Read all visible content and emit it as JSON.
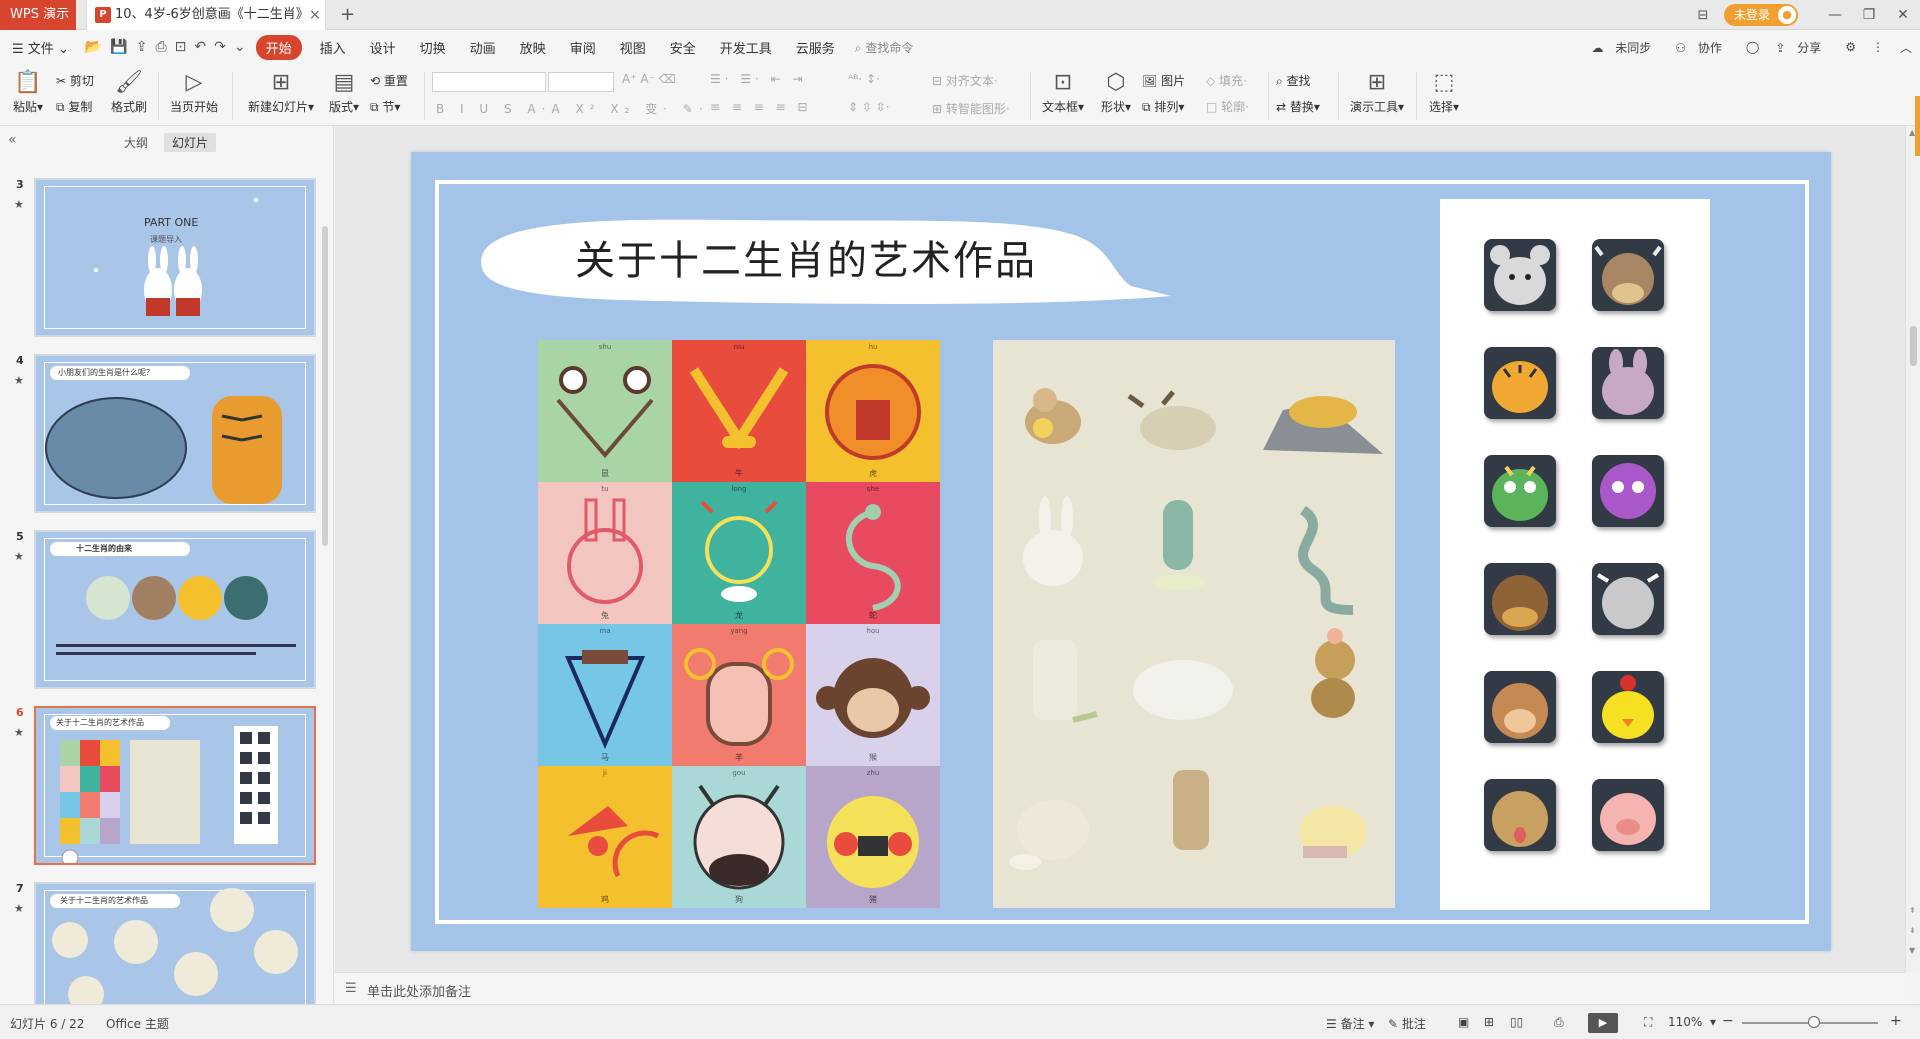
{
  "titlebar": {
    "app_tab": "WPS 演示",
    "doc_tab": "10、4岁-6岁创意画《十二生肖》",
    "doc_icon": "P",
    "login": "未登录",
    "new_tab": "+"
  },
  "menubar": {
    "file": "文件",
    "items": [
      "开始",
      "插入",
      "设计",
      "切换",
      "动画",
      "放映",
      "审阅",
      "视图",
      "安全",
      "开发工具",
      "云服务"
    ],
    "search": "查找命令",
    "right": [
      "未同步",
      "协作",
      "分享"
    ]
  },
  "ribbon": {
    "paste": "粘贴",
    "cut": "剪切",
    "copy": "复制",
    "format_painter": "格式刷",
    "play_from_current": "当页开始",
    "new_slide": "新建幻灯片",
    "layout": "版式",
    "reset": "重置",
    "section": "节",
    "align_text": "对齐文本",
    "smart_graphic": "转智能图形",
    "textbox": "文本框",
    "shape": "形状",
    "picture": "图片",
    "arrange": "排列",
    "fill": "填充",
    "outline": "轮廓",
    "find": "查找",
    "replace": "替换",
    "presentation_tools": "演示工具",
    "select": "选择"
  },
  "leftpanel": {
    "tab_outline": "大纲",
    "tab_slides": "幻灯片",
    "thumbnails": [
      {
        "num": "3",
        "text_a": "PART ONE",
        "text_b": "课题导入"
      },
      {
        "num": "4",
        "text_a": "小朋友们的生肖是什么呢？",
        "text_b": ""
      },
      {
        "num": "5",
        "text_a": "十二生肖的由来",
        "text_b": ""
      },
      {
        "num": "6",
        "text_a": "关于十二生肖的艺术作品",
        "text_b": ""
      },
      {
        "num": "7",
        "text_a": "关于十二生肖的艺术作品",
        "text_b": ""
      }
    ]
  },
  "slide": {
    "title": "关于十二生肖的艺术作品",
    "zodiac_cells": [
      {
        "py": "shu",
        "zh": "鼠",
        "bg": "#a8d4a6"
      },
      {
        "py": "niu",
        "zh": "牛",
        "bg": "#e74c3c"
      },
      {
        "py": "hu",
        "zh": "虎",
        "bg": "#f5c02e"
      },
      {
        "py": "tu",
        "zh": "兔",
        "bg": "#f2c5c0"
      },
      {
        "py": "long",
        "zh": "龙",
        "bg": "#3fb39d"
      },
      {
        "py": "she",
        "zh": "蛇",
        "bg": "#e84a5f"
      },
      {
        "py": "ma",
        "zh": "马",
        "bg": "#76c6e6"
      },
      {
        "py": "yang",
        "zh": "羊",
        "bg": "#f07b6e"
      },
      {
        "py": "hou",
        "zh": "猴",
        "bg": "#d8d1ec"
      },
      {
        "py": "ji",
        "zh": "鸡",
        "bg": "#f5c02e"
      },
      {
        "py": "gou",
        "zh": "狗",
        "bg": "#a9d8d6"
      },
      {
        "py": "zhu",
        "zh": "猪",
        "bg": "#b7a6c9"
      }
    ]
  },
  "notes": {
    "placeholder": "单击此处添加备注"
  },
  "statusbar": {
    "slide_counter": "幻灯片 6 / 22",
    "theme": "Office 主题",
    "notes": "备注",
    "comments": "批注",
    "zoom": "110%"
  },
  "colors": {
    "accent": "#d8452e",
    "slide_bg": "#a3c4e8",
    "login": "#f0a030"
  }
}
